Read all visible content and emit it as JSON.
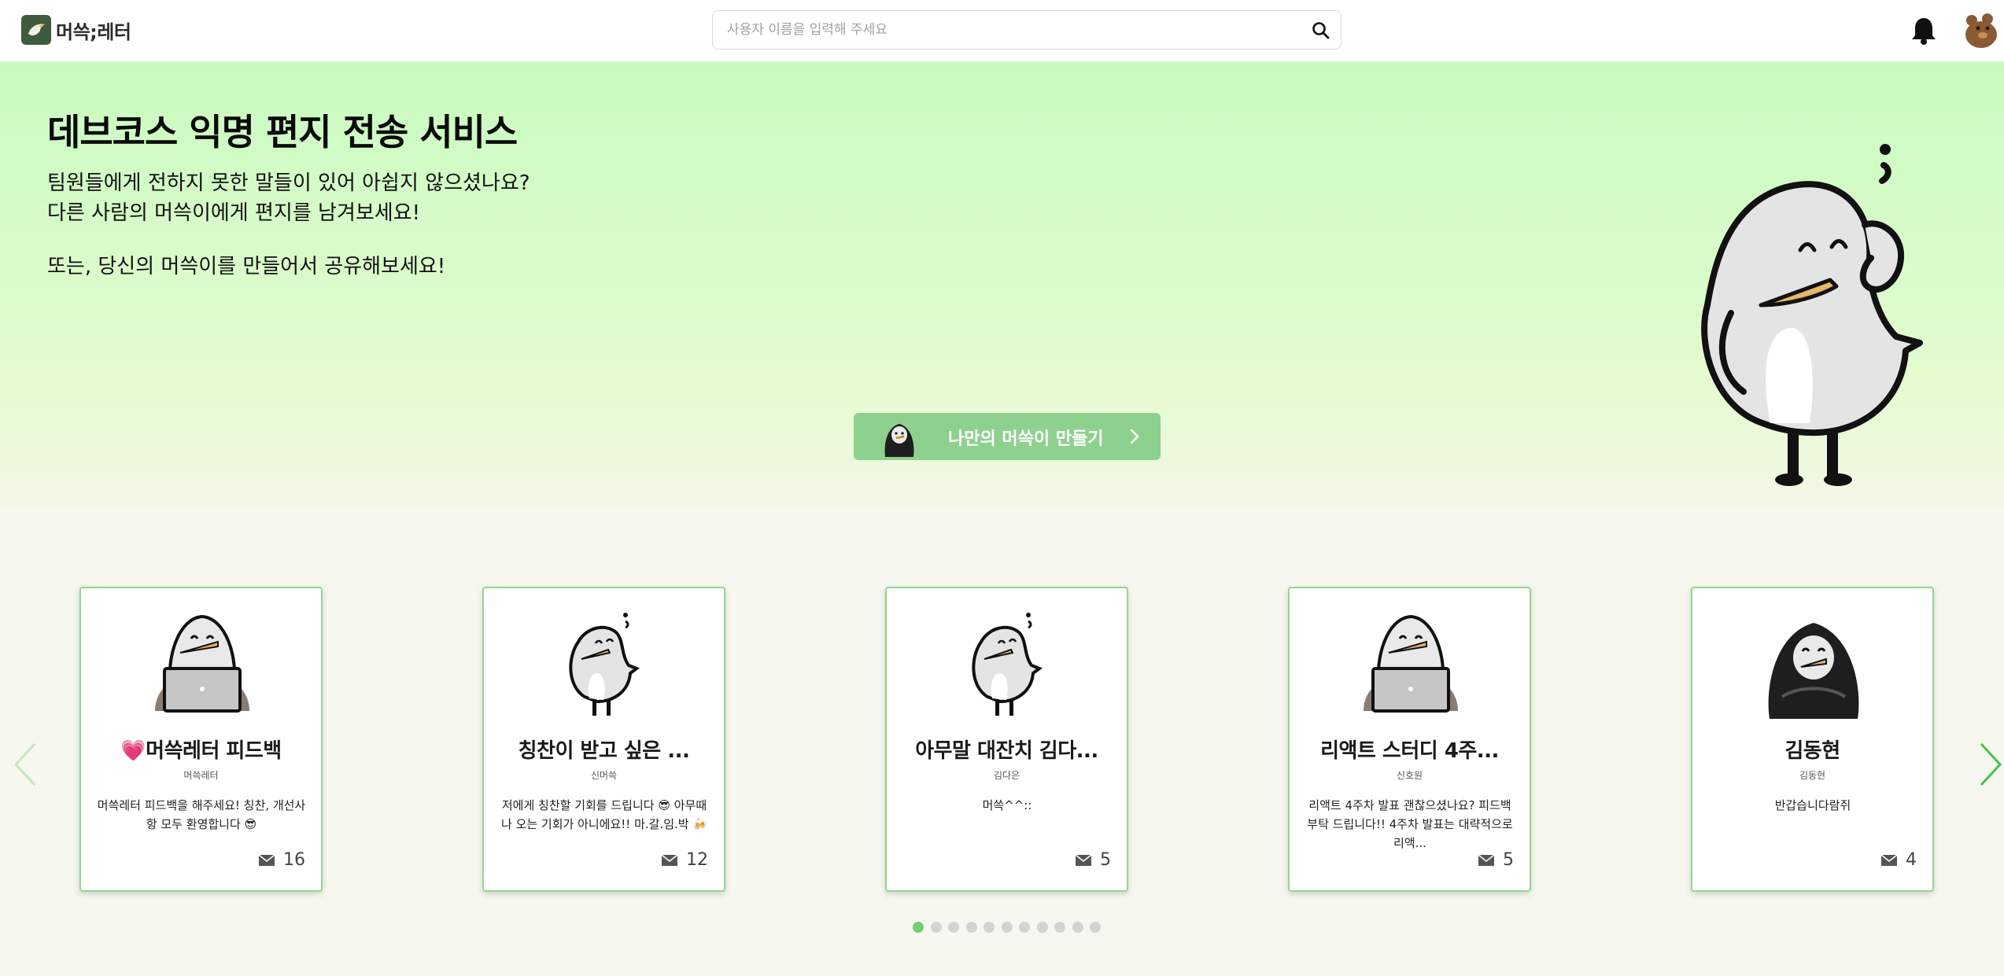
{
  "header": {
    "logo_text": "머쓱;레터",
    "search_placeholder": "사용자 이름을 입력해 주세요"
  },
  "hero": {
    "title": "데브코스 익명 편지 전송 서비스",
    "line1": "팀원들에게 전하지 못한 말들이 있어 아쉽지 않으셨나요?",
    "line2": "다른 사람의 머쓱이에게 편지를 남겨보세요!",
    "line3": "또는, 당신의 머쓱이를 만들어서 공유해보세요!",
    "cta_label": "나만의 머쓱이 만들기"
  },
  "colors": {
    "accent": "#8ed18f",
    "card_border": "#8fd98f",
    "active_dot": "#6ecf6e"
  },
  "cards": [
    {
      "illustration": "laptop-bird",
      "title": "💗머쓱레터 피드백",
      "author": "머쓱레터",
      "description": "머쓱레터 피드백을 해주세요! 칭찬, 개선사항 모두 환영합니다 😎",
      "count": "16"
    },
    {
      "illustration": "thinking-bird",
      "title": "칭찬이 받고 싶은 ...",
      "author": "신머쓱",
      "description": "저에게 칭찬할 기회를 드립니다 😎 아무때나 오는 기회가 아니에요!! 마.갈.임.박 🍻",
      "count": "12"
    },
    {
      "illustration": "thinking-bird",
      "title": "아무말 대잔치 김다...",
      "author": "김다은",
      "description": "머쓱^^::",
      "count": "5"
    },
    {
      "illustration": "laptop-bird",
      "title": "리액트 스터디 4주...",
      "author": "신호원",
      "description": "리액트 4주차 발표 괜찮으셨나요? 피드백 부탁 드립니다!! 4주차 발표는 대략적으로 리액...",
      "count": "5"
    },
    {
      "illustration": "hoodie-bird",
      "title": "김동현",
      "author": "김동현",
      "description": "반갑습니다람쥐",
      "count": "4"
    }
  ],
  "pagination": {
    "total": 11,
    "active": 1
  }
}
